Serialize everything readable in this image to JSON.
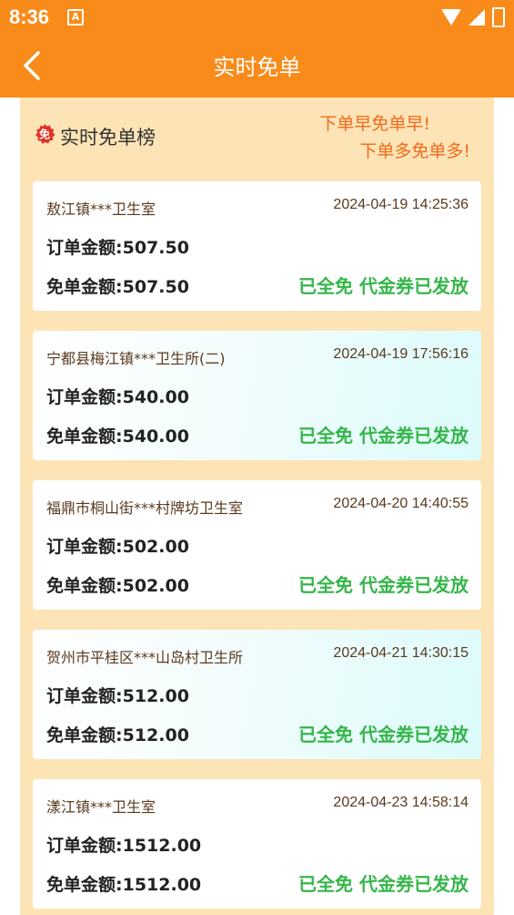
{
  "status_bar": {
    "time": "8:36",
    "app_icon": "A"
  },
  "header": {
    "title": "实时免单",
    "back_icon": "chevron-left-icon"
  },
  "panel": {
    "badge_icon": "免",
    "title": "实时免单榜",
    "slogan_line1": "下单早免单早!",
    "slogan_line2": "下单多免单多!"
  },
  "colors": {
    "header_bg": "#f98b1a",
    "panel_bg": "#fde4b6",
    "status_green": "#35b64a",
    "slogan_orange": "#f26a1b"
  },
  "records": [
    {
      "clinic": "敖江镇***卫生室",
      "time": "2024-04-19 14:25:36",
      "order_amount": "订单金额:507.50",
      "free_amount": "免单金额:507.50",
      "status": "已全免 代金券已发放"
    },
    {
      "clinic": "宁都县梅江镇***卫生所(二)",
      "time": "2024-04-19 17:56:16",
      "order_amount": "订单金额:540.00",
      "free_amount": "免单金额:540.00",
      "status": "已全免 代金券已发放"
    },
    {
      "clinic": "福鼎市桐山街***村牌坊卫生室",
      "time": "2024-04-20 14:40:55",
      "order_amount": "订单金额:502.00",
      "free_amount": "免单金额:502.00",
      "status": "已全免 代金券已发放"
    },
    {
      "clinic": "贺州市平桂区***山岛村卫生所",
      "time": "2024-04-21 14:30:15",
      "order_amount": "订单金额:512.00",
      "free_amount": "免单金额:512.00",
      "status": "已全免 代金券已发放"
    },
    {
      "clinic": "漾江镇***卫生室",
      "time": "2024-04-23 14:58:14",
      "order_amount": "订单金额:1512.00",
      "free_amount": "免单金额:1512.00",
      "status": "已全免 代金券已发放"
    }
  ]
}
